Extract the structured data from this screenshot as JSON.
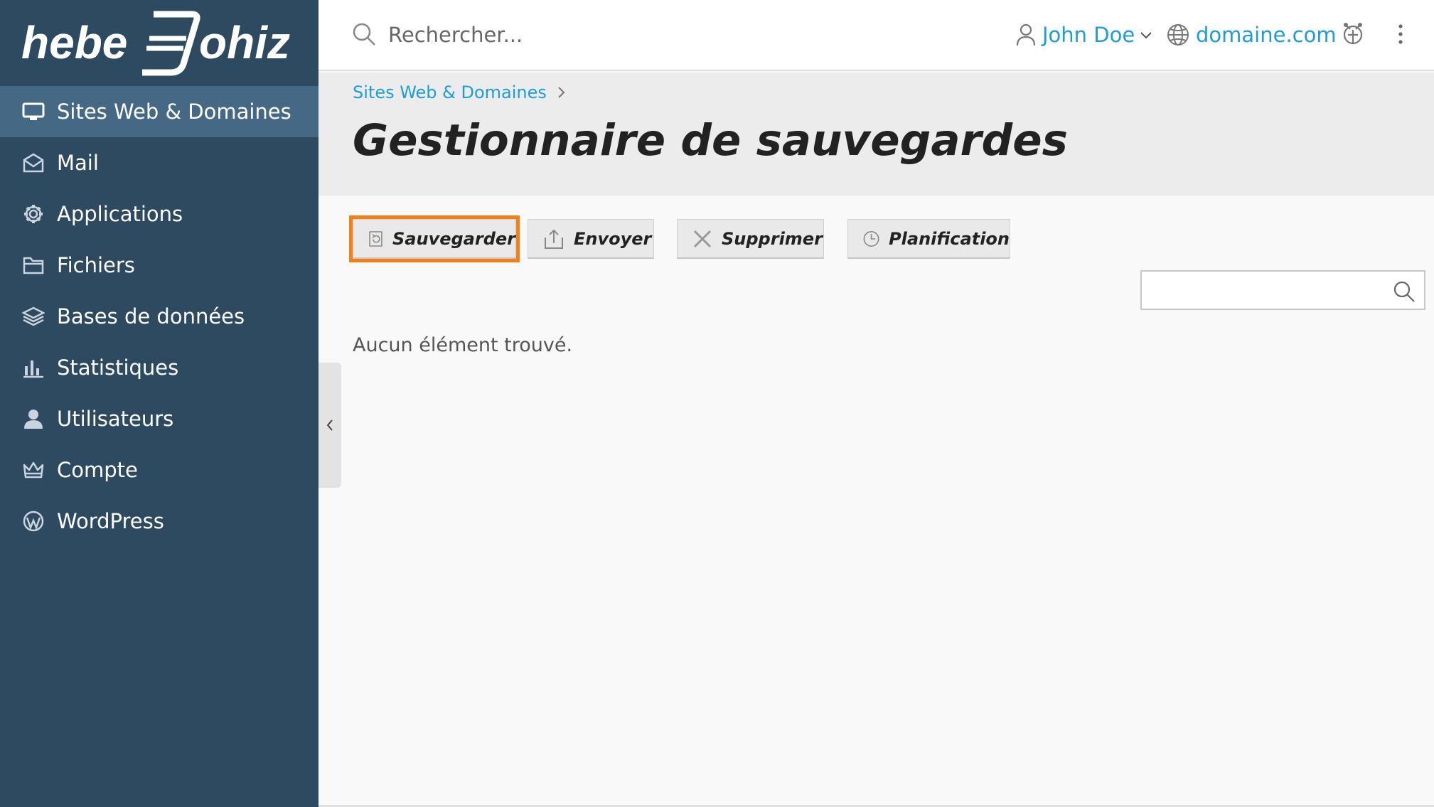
{
  "brand": {
    "logo_text_left": "hebe",
    "logo_text_right": "ohiz",
    "sidebar_bg": "#2e4a61",
    "sidebar_active_bg": "#456985",
    "accent": "#1d9dd8",
    "highlight": "#f47f16"
  },
  "sidebar": {
    "items": [
      {
        "label": "Sites Web & Domaines",
        "icon": "monitor-icon",
        "active": true
      },
      {
        "label": "Mail",
        "icon": "envelope-icon"
      },
      {
        "label": "Applications",
        "icon": "gear-icon"
      },
      {
        "label": "Fichiers",
        "icon": "folder-icon"
      },
      {
        "label": "Bases de données",
        "icon": "database-layers-icon"
      },
      {
        "label": "Statistiques",
        "icon": "bar-chart-icon"
      },
      {
        "label": "Utilisateurs",
        "icon": "user-icon"
      },
      {
        "label": "Compte",
        "icon": "crown-icon"
      },
      {
        "label": "WordPress",
        "icon": "wordpress-icon"
      }
    ]
  },
  "topbar": {
    "search_placeholder": "Rechercher...",
    "user_name": "John Doe",
    "domain": "domaine.com"
  },
  "header": {
    "breadcrumb": "Sites Web & Domaines",
    "title": "Gestionnaire de sauvegardes"
  },
  "toolbar": {
    "backup_label": "Sauvegarder",
    "upload_label": "Envoyer",
    "delete_label": "Supprimer",
    "schedule_label": "Planification"
  },
  "list": {
    "search_value": "",
    "empty_message": "Aucun élément trouvé."
  }
}
